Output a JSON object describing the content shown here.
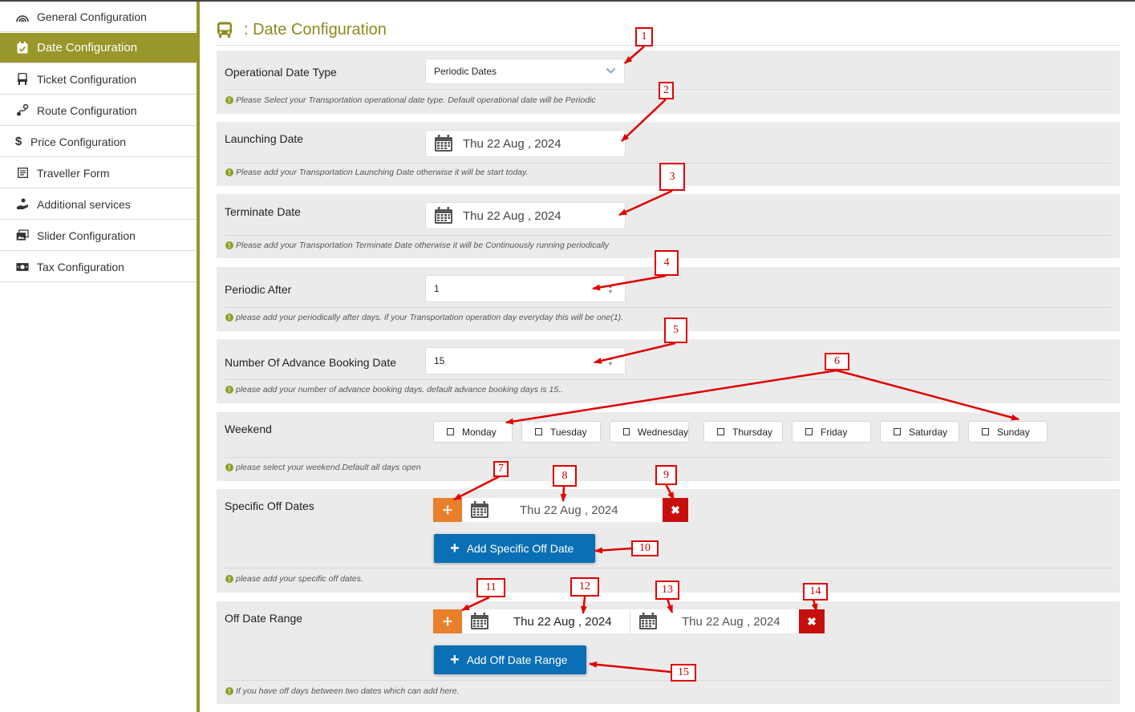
{
  "sidebar": {
    "items": [
      {
        "label": "General Configuration",
        "icon": "rainbow-icon"
      },
      {
        "label": "Date Configuration",
        "icon": "calendar-check-icon",
        "active": true
      },
      {
        "label": "Ticket Configuration",
        "icon": "seat-icon"
      },
      {
        "label": "Route Configuration",
        "icon": "route-icon"
      },
      {
        "label": "Price Configuration",
        "icon": "dollar-icon"
      },
      {
        "label": "Traveller Form",
        "icon": "form-icon"
      },
      {
        "label": "Additional services",
        "icon": "service-hand-icon"
      },
      {
        "label": "Slider Configuration",
        "icon": "images-icon"
      },
      {
        "label": "Tax Configuration",
        "icon": "money-icon"
      }
    ]
  },
  "header": {
    "title": ": Date Configuration",
    "icon": "bus-icon"
  },
  "fields": {
    "operational_date_type": {
      "label": "Operational Date Type",
      "value": "Periodic Dates",
      "help": "Please Select your Transportation operational date type. Default operational date will be Periodic"
    },
    "launching_date": {
      "label": "Launching Date",
      "value": "Thu 22 Aug , 2024",
      "help": "Please add your Transportation Launching Date otherwise it will be start today."
    },
    "terminate_date": {
      "label": "Terminate Date",
      "value": "Thu 22 Aug , 2024",
      "help": "Please add your Transportation Terminate Date otherwise it will be Continuously running periodically"
    },
    "periodic_after": {
      "label": "Periodic After",
      "value": "1",
      "help": "please add your periodically after days. if your Transportation operation day everyday this will be one(1)."
    },
    "advance_booking": {
      "label": "Number Of Advance Booking Date",
      "value": "15",
      "help": "please add your number of advance booking days. default advance booking days is 15.."
    },
    "weekend": {
      "label": "Weekend",
      "days": [
        "Monday",
        "Tuesday",
        "Wednesday",
        "Thursday",
        "Friday",
        "Saturday",
        "Sunday"
      ],
      "help": "please select your weekend.Default all days open"
    },
    "specific_off": {
      "label": "Specific Off Dates",
      "date": "Thu 22 Aug , 2024",
      "button": "Add Specific Off Date",
      "help": "please add your specific off dates."
    },
    "off_range": {
      "label": "Off Date Range",
      "start": "Thu 22 Aug , 2024",
      "end": "Thu 22 Aug , 2024",
      "button": "Add Off Date Range",
      "help": "If you have off days between two dates which can add here."
    }
  },
  "annotations": [
    "1",
    "2",
    "3",
    "4",
    "5",
    "6",
    "7",
    "8",
    "9",
    "10",
    "11",
    "12",
    "13",
    "14",
    "15"
  ],
  "colors": {
    "accent": "#99962a",
    "title": "#8d8a1e",
    "button": "#0a6fb5",
    "move": "#e97f2a",
    "delete": "#c80d0d",
    "annotation": "#e00000"
  }
}
